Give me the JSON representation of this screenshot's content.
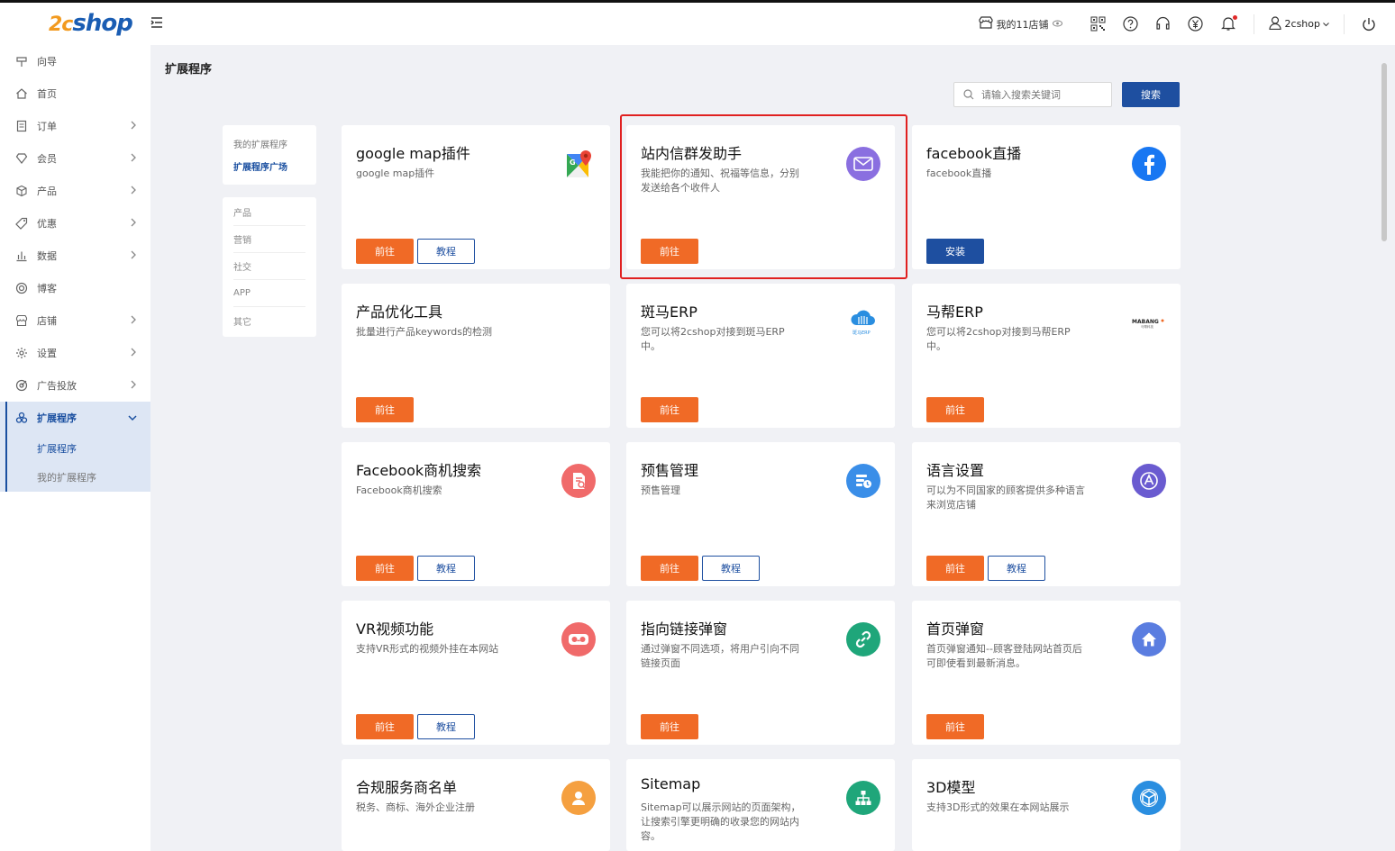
{
  "header": {
    "logo_prefix": "2c",
    "logo_text": "shop",
    "store_label": "我的11店铺",
    "user_name": "2cshop"
  },
  "sidebar": {
    "items": [
      {
        "label": "向导",
        "icon": "guide-icon",
        "chevron": false
      },
      {
        "label": "首页",
        "icon": "home-icon",
        "chevron": false
      },
      {
        "label": "订单",
        "icon": "order-icon",
        "chevron": true
      },
      {
        "label": "会员",
        "icon": "member-icon",
        "chevron": true
      },
      {
        "label": "产品",
        "icon": "product-icon",
        "chevron": true
      },
      {
        "label": "优惠",
        "icon": "discount-icon",
        "chevron": true
      },
      {
        "label": "数据",
        "icon": "data-icon",
        "chevron": true
      },
      {
        "label": "博客",
        "icon": "blog-icon",
        "chevron": false
      },
      {
        "label": "店铺",
        "icon": "store-icon",
        "chevron": true
      },
      {
        "label": "设置",
        "icon": "settings-icon",
        "chevron": true
      },
      {
        "label": "广告投放",
        "icon": "ads-icon",
        "chevron": true
      },
      {
        "label": "扩展程序",
        "icon": "extensions-icon",
        "chevron": true
      }
    ],
    "sub_items": [
      "扩展程序",
      "我的扩展程序"
    ]
  },
  "main": {
    "title": "扩展程序",
    "search_placeholder": "请输入搜索关键词",
    "search_button": "搜索",
    "filter_top": [
      "我的扩展程序",
      "扩展程序广场"
    ],
    "categories": [
      "产品",
      "营销",
      "社交",
      "APP",
      "其它"
    ]
  },
  "buttons": {
    "go": "前往",
    "tutorial": "教程",
    "install": "安装"
  },
  "cards": [
    {
      "title": "google map插件",
      "desc": "google map插件",
      "icon": "google-maps-icon",
      "color": "#34a853",
      "buttons": [
        "go",
        "tutorial"
      ]
    },
    {
      "title": "站内信群发助手",
      "desc": "我能把你的通知、祝福等信息，分别发送给各个收件人",
      "icon": "mail-icon",
      "color": "#8a6fe0",
      "buttons": [
        "go"
      ]
    },
    {
      "title": "facebook直播",
      "desc": "facebook直播",
      "icon": "facebook-icon",
      "color": "#1877f2",
      "buttons": [
        "install"
      ]
    },
    {
      "title": "产品优化工具",
      "desc": "批量进行产品keywords的检测",
      "icon": "",
      "color": "",
      "buttons": [
        "go"
      ]
    },
    {
      "title": "斑马ERP",
      "desc": "您可以将2cshop对接到斑马ERP中。",
      "icon": "zebra-erp-icon",
      "color": "#2a8ee0",
      "buttons": [
        "go"
      ]
    },
    {
      "title": "马帮ERP",
      "desc": "您可以将2cshop对接到马帮ERP中。",
      "icon": "mabang-erp-icon",
      "color": "#333333",
      "buttons": [
        "go"
      ]
    },
    {
      "title": "Facebook商机搜索",
      "desc": "Facebook商机搜索",
      "icon": "document-search-icon",
      "color": "#f06a6a",
      "buttons": [
        "go",
        "tutorial"
      ]
    },
    {
      "title": "预售管理",
      "desc": "预售管理",
      "icon": "presale-icon",
      "color": "#3a8ee8",
      "buttons": [
        "go",
        "tutorial"
      ]
    },
    {
      "title": "语言设置",
      "desc": "可以为不同国家的顾客提供多种语言来浏览店铺",
      "icon": "language-icon",
      "color": "#6a5bd0",
      "buttons": [
        "go",
        "tutorial"
      ]
    },
    {
      "title": "VR视频功能",
      "desc": "支持VR形式的视频外挂在本网站",
      "icon": "vr-icon",
      "color": "#f06a6a",
      "buttons": [
        "go",
        "tutorial"
      ]
    },
    {
      "title": "指向链接弹窗",
      "desc": "通过弹窗不同选项，将用户引向不同链接页面",
      "icon": "link-icon",
      "color": "#1fa67a",
      "buttons": [
        "go"
      ]
    },
    {
      "title": "首页弹窗",
      "desc": "首页弹窗通知--顾客登陆网站首页后可即使看到最新消息。",
      "icon": "home-popup-icon",
      "color": "#5a7de0",
      "buttons": [
        "go"
      ]
    },
    {
      "title": "合规服务商名单",
      "desc": "税务、商标、海外企业注册",
      "icon": "person-icon",
      "color": "#f5a040",
      "buttons": []
    },
    {
      "title": "Sitemap",
      "desc": "Sitemap可以展示网站的页面架构，让搜索引擎更明确的收录您的网站内容。",
      "icon": "sitemap-icon",
      "color": "#1fa67a",
      "buttons": []
    },
    {
      "title": "3D模型",
      "desc": "支持3D形式的效果在本网站展示",
      "icon": "cube-icon",
      "color": "#2a8ee0",
      "buttons": []
    }
  ]
}
